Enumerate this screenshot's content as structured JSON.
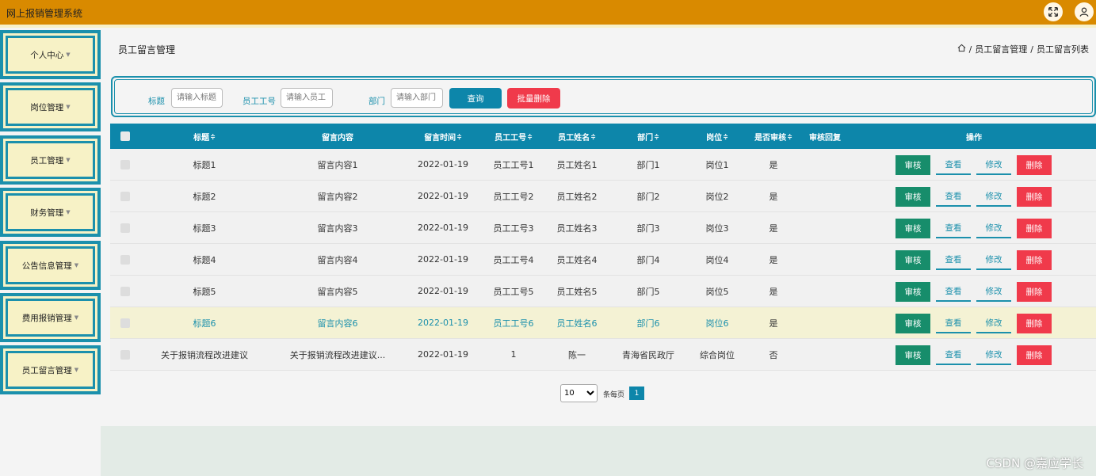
{
  "app_title": "网上报销管理系统",
  "sidebar": {
    "items": [
      {
        "label": "个人中心"
      },
      {
        "label": "岗位管理"
      },
      {
        "label": "员工管理"
      },
      {
        "label": "财务管理"
      },
      {
        "label": "公告信息管理"
      },
      {
        "label": "费用报销管理"
      },
      {
        "label": "员工留言管理"
      }
    ]
  },
  "page_title": "员工留言管理",
  "breadcrumb": {
    "sep": "/",
    "level1": "员工留言管理",
    "level2": "员工留言列表"
  },
  "search": {
    "title_label": "标题",
    "title_placeholder": "请输入标题",
    "empno_label": "员工工号",
    "empno_placeholder": "请输入员工",
    "dept_label": "部门",
    "dept_placeholder": "请输入部门",
    "query_button": "查询",
    "batch_delete_button": "批量删除"
  },
  "table": {
    "headers": {
      "title": "标题",
      "content": "留言内容",
      "time": "留言时间",
      "empno": "员工工号",
      "empname": "员工姓名",
      "dept": "部门",
      "post": "岗位",
      "audited": "是否审核",
      "reply": "审核回复",
      "ops": "操作",
      "sort_glyph": "≑"
    },
    "rows": [
      {
        "title": "标题1",
        "content": "留言内容1",
        "time": "2022-01-19",
        "empno": "员工工号1",
        "empname": "员工姓名1",
        "dept": "部门1",
        "post": "岗位1",
        "audited": "是",
        "reply": ""
      },
      {
        "title": "标题2",
        "content": "留言内容2",
        "time": "2022-01-19",
        "empno": "员工工号2",
        "empname": "员工姓名2",
        "dept": "部门2",
        "post": "岗位2",
        "audited": "是",
        "reply": ""
      },
      {
        "title": "标题3",
        "content": "留言内容3",
        "time": "2022-01-19",
        "empno": "员工工号3",
        "empname": "员工姓名3",
        "dept": "部门3",
        "post": "岗位3",
        "audited": "是",
        "reply": ""
      },
      {
        "title": "标题4",
        "content": "留言内容4",
        "time": "2022-01-19",
        "empno": "员工工号4",
        "empname": "员工姓名4",
        "dept": "部门4",
        "post": "岗位4",
        "audited": "是",
        "reply": ""
      },
      {
        "title": "标题5",
        "content": "留言内容5",
        "time": "2022-01-19",
        "empno": "员工工号5",
        "empname": "员工姓名5",
        "dept": "部门5",
        "post": "岗位5",
        "audited": "是",
        "reply": ""
      },
      {
        "title": "标题6",
        "content": "留言内容6",
        "time": "2022-01-19",
        "empno": "员工工号6",
        "empname": "员工姓名6",
        "dept": "部门6",
        "post": "岗位6",
        "audited": "是",
        "reply": ""
      },
      {
        "title": "关于报销流程改进建议",
        "content": "关于报销流程改进建议...",
        "time": "2022-01-19",
        "empno": "1",
        "empname": "陈一",
        "dept": "青海省民政厅",
        "post": "综合岗位",
        "audited": "否",
        "reply": ""
      }
    ],
    "actions": {
      "audit": "审核",
      "view": "查看",
      "edit": "修改",
      "delete": "删除"
    }
  },
  "pagination": {
    "page_size": "10",
    "per_page_label": "条每页",
    "current_page": "1"
  },
  "watermark": "CSDN @嘉应学长",
  "colors": {
    "topbar": "#d98a00",
    "accent": "#0d86aa",
    "danger": "#f03a4b",
    "audit": "#178d6b",
    "sidebar_bg": "#f7f2c6"
  }
}
